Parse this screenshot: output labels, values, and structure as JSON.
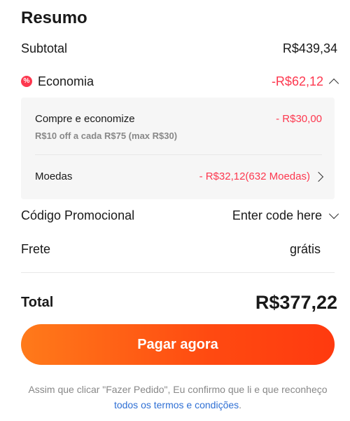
{
  "summary": {
    "title": "Resumo",
    "subtotal": {
      "label": "Subtotal",
      "value": "R$439,34"
    },
    "economia": {
      "badge": "%",
      "label": "Economia",
      "value": "-R$62,12",
      "items": [
        {
          "label": "Compre e economize",
          "value": "- R$30,00",
          "sublabel": "R$10 off a cada R$75 (max R$30)"
        },
        {
          "label": "Moedas",
          "value": "- R$32,12(632 Moedas)"
        }
      ]
    },
    "promo": {
      "label": "Código Promocional",
      "value": "Enter code here"
    },
    "frete": {
      "label": "Frete",
      "value": "grátis"
    },
    "total": {
      "label": "Total",
      "value": "R$377,22"
    }
  },
  "actions": {
    "pay_label": "Pagar agora"
  },
  "footer": {
    "text": "Assim que clicar \"Fazer Pedido\", Eu confirmo que li e que reconheço",
    "link": "todos os termos e condições",
    "end": "."
  },
  "colors": {
    "accent": "#ff4a11",
    "discount": "#fd384f",
    "link": "#2e6fd4"
  },
  "icons": {
    "badge": "percent-badge-icon",
    "economia_toggle": "chevron-up-icon",
    "moedas": "chevron-right-icon",
    "promo": "chevron-down-icon"
  }
}
